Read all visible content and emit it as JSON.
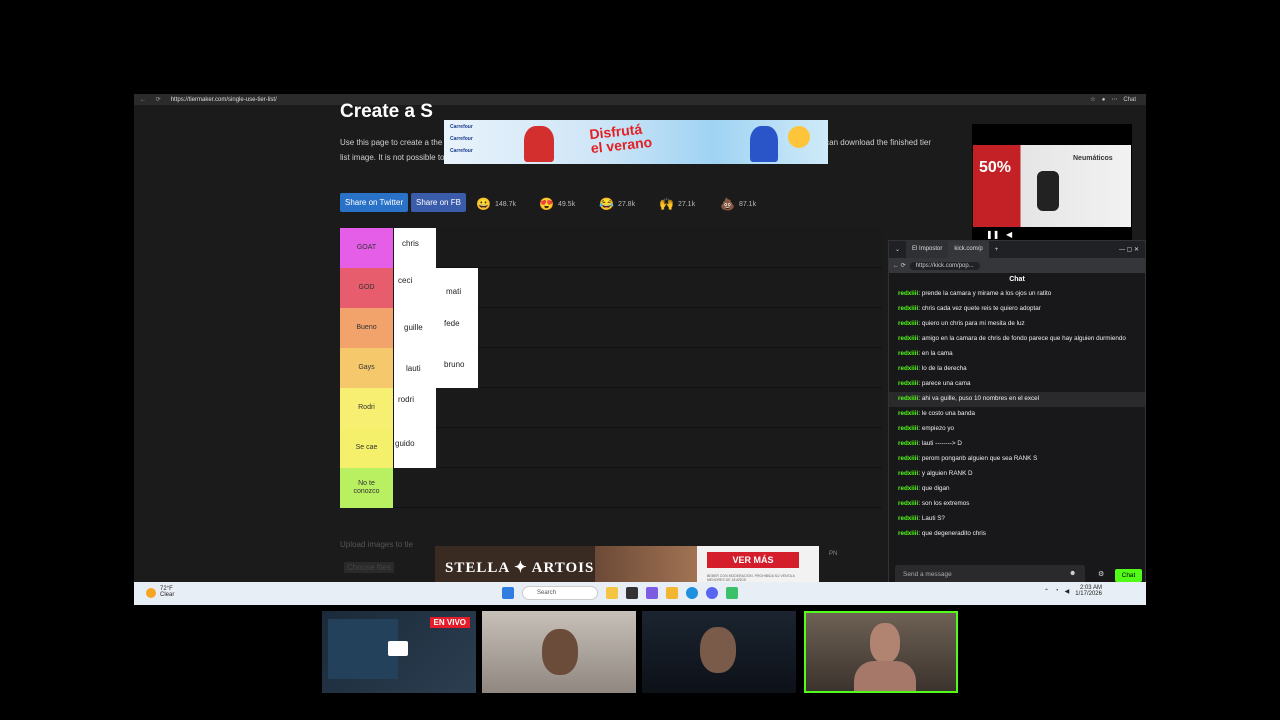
{
  "browser": {
    "url": "https://tiermaker.com/single-use-tier-list/",
    "right_label": "Chat"
  },
  "page": {
    "title": "Create a S",
    "description": "Use this page to create a                                                                                                                   the website. Use the Upload button below the tier list to add your images. Once you have finished your list, you can download the finished tier list image. It is not possible to save a single-use tier list to your profile page. Refreshing the page will cause your images to be removed.",
    "share_twitter": "Share on Twitter",
    "share_fb": "Share on FB",
    "reactions": [
      {
        "icon": "😀",
        "count": "148.7k"
      },
      {
        "icon": "😍",
        "count": "49.5k"
      },
      {
        "icon": "😂",
        "count": "27.8k"
      },
      {
        "icon": "🙌",
        "count": "27.1k"
      },
      {
        "icon": "💩",
        "count": "87.1k"
      }
    ],
    "upload_hint": "Upload images to tie",
    "choose_files": "Choose files",
    "pn": "PN"
  },
  "tiers": [
    {
      "label": "GOAT",
      "color": "#e45ee8",
      "items": [
        {
          "text": "chris"
        }
      ]
    },
    {
      "label": "GOD",
      "color": "#e85d6e",
      "items": [
        {
          "text": "ceci"
        },
        {
          "text": "mati"
        }
      ]
    },
    {
      "label": "Bueno",
      "color": "#f2a36b",
      "items": [
        {
          "text": "guille"
        },
        {
          "text": "fede"
        }
      ]
    },
    {
      "label": "Gays",
      "color": "#f5c96b",
      "items": [
        {
          "text": "lauti"
        },
        {
          "text": "bruno"
        }
      ]
    },
    {
      "label": "Rodri",
      "color": "#f6ef71",
      "items": [
        {
          "text": "rodri"
        }
      ]
    },
    {
      "label": "Se cae",
      "color": "#f4f06b",
      "items": [
        {
          "text": "guido"
        }
      ]
    },
    {
      "label": "No te conozco",
      "color": "#b8f061",
      "items": []
    }
  ],
  "ads": {
    "top_brand": "Carrefour",
    "top_headline_1": "Disfrutá",
    "top_headline_2": "el verano",
    "video_title": "Neumáticos",
    "video_pct": "50%",
    "bottom_brand": "STELLA ✦ ARTOIS",
    "bottom_cta": "VER MÁS",
    "bottom_small": "BEBER CON MODERACIÓN. PROHIBIDA SU VENTA A MENORES DE 18 AÑOS"
  },
  "chat": {
    "tabs": [
      {
        "label": "El Impostor"
      },
      {
        "label": "kick.com/p"
      }
    ],
    "address": "https://kick.com/pop...",
    "header": "Chat",
    "messages": [
      {
        "user": "redxiiii",
        "text": "prende la camara y mirame a los ojos un ratito"
      },
      {
        "user": "redxiiii",
        "text": "chris cada vez quete reis te quiero adoptar"
      },
      {
        "user": "redxiiii",
        "text": "quiero un chris para mi mesita de luz"
      },
      {
        "user": "redxiiii",
        "text": "amigo en la camara de chris de fondo parece que hay alguien durmiendo"
      },
      {
        "user": "redxiiii",
        "text": "en la cama"
      },
      {
        "user": "redxiiii",
        "text": "lo de la derecha"
      },
      {
        "user": "redxiiii",
        "text": "parece una cama"
      },
      {
        "user": "redxiiii",
        "text": "ahi va guille, puso 10 nombres en el excel"
      },
      {
        "user": "redxiiii",
        "text": "le costo una banda"
      },
      {
        "user": "redxiiii",
        "text": "empiezo yo"
      },
      {
        "user": "redxiiii",
        "text": "lauti --------> D"
      },
      {
        "user": "redxiiii",
        "text": "perom ponganb alguien que sea RANK S"
      },
      {
        "user": "redxiiii",
        "text": "y alguien RANK D"
      },
      {
        "user": "redxiiii",
        "text": "que digan"
      },
      {
        "user": "redxiiii",
        "text": "son los extremos"
      },
      {
        "user": "redxiiii",
        "text": "Lauti S?"
      },
      {
        "user": "redxiiii",
        "text": "que degeneradito chris"
      }
    ],
    "input_placeholder": "Send a message",
    "send_label": "Chat"
  },
  "taskbar": {
    "temp": "72°F",
    "weather": "Clear",
    "search": "Search",
    "time": "2:03 AM",
    "date": "1/17/2026"
  },
  "stream": {
    "live_badge": "EN VIVO"
  }
}
